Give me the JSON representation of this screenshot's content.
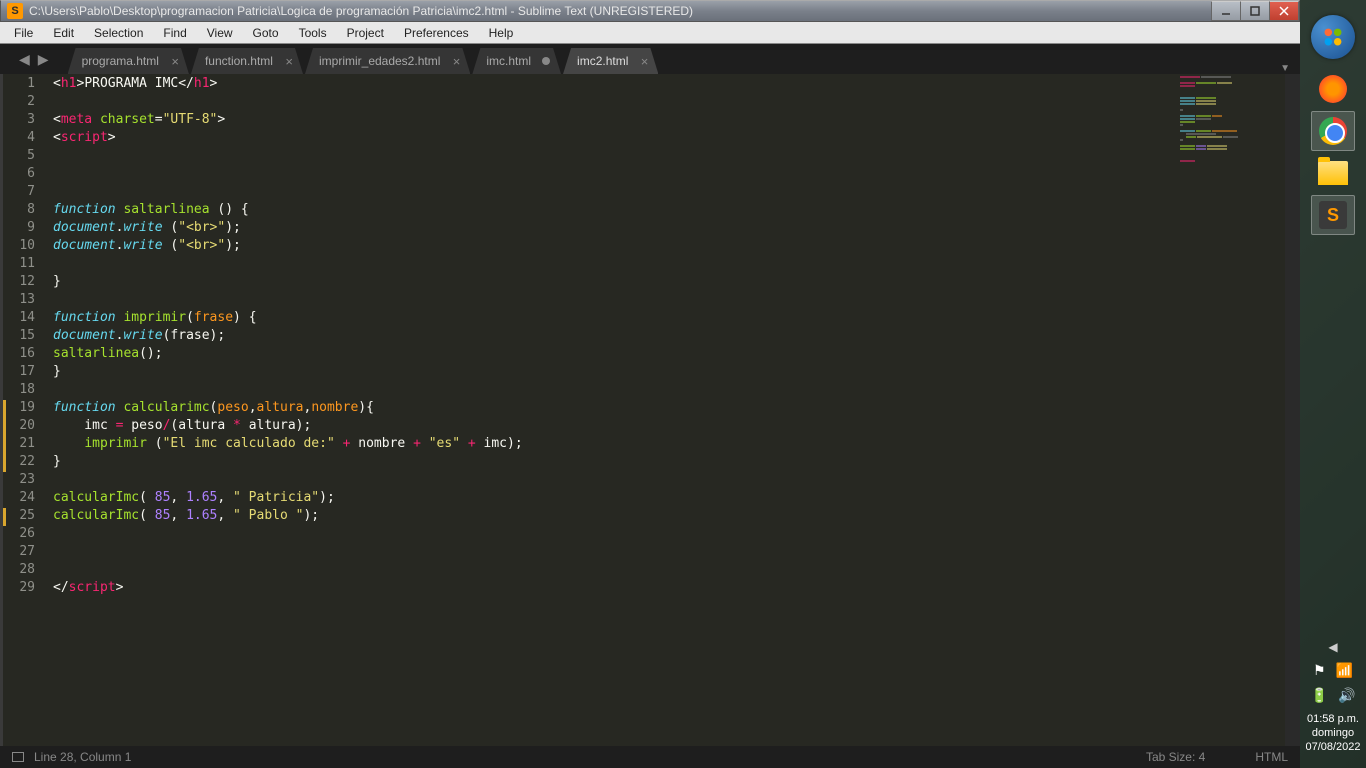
{
  "titlebar": {
    "icon_letter": "S",
    "text": "C:\\Users\\Pablo\\Desktop\\programacion Patricia\\Logica de programación Patricia\\imc2.html - Sublime Text (UNREGISTERED)"
  },
  "menu": [
    "File",
    "Edit",
    "Selection",
    "Find",
    "View",
    "Goto",
    "Tools",
    "Project",
    "Preferences",
    "Help"
  ],
  "tabs": [
    {
      "label": "programa.html",
      "modified": false,
      "active": false
    },
    {
      "label": "function.html",
      "modified": false,
      "active": false
    },
    {
      "label": "imprimir_edades2.html",
      "modified": false,
      "active": false
    },
    {
      "label": "imc.html",
      "modified": true,
      "active": false
    },
    {
      "label": "imc2.html",
      "modified": false,
      "active": true
    }
  ],
  "line_count": 29,
  "accent_lines": [
    19,
    20,
    21,
    22,
    25
  ],
  "code": {
    "l1": {
      "a": "<",
      "b": "h1",
      "c": ">",
      "d": "PROGRAMA IMC",
      "e": "</",
      "f": "h1",
      "g": ">"
    },
    "l3": {
      "a": "<",
      "b": "meta ",
      "c": "charset",
      "d": "=",
      "e": "\"UTF-8\"",
      "f": ">"
    },
    "l4": {
      "a": "<",
      "b": "script",
      "c": ">"
    },
    "l8": {
      "a": "function",
      "b": " saltarlinea",
      "c": " () {"
    },
    "l9": {
      "a": "document",
      "b": ".",
      "c": "write",
      "d": " (",
      "e": "\"<br>\"",
      "f": ");"
    },
    "l10": {
      "a": "document",
      "b": ".",
      "c": "write",
      "d": " (",
      "e": "\"<br>\"",
      "f": ");"
    },
    "l12": {
      "a": "}"
    },
    "l14": {
      "a": "function",
      "b": " imprimir",
      "c": "(",
      "d": "frase",
      "e": ") {"
    },
    "l15": {
      "a": "document",
      "b": ".",
      "c": "write",
      "d": "(frase);"
    },
    "l16": {
      "a": "saltarlinea",
      "b": "();"
    },
    "l17": {
      "a": "}"
    },
    "l19": {
      "a": "function",
      "b": " calcularimc",
      "c": "(",
      "d": "peso",
      "e": ",",
      "f": "altura",
      "g": ",",
      "h": "nombre",
      "i": "){"
    },
    "l20": {
      "a": "    imc ",
      "b": "=",
      "c": " peso",
      "d": "/",
      "e": "(altura ",
      "f": "*",
      "g": " altura);"
    },
    "l21": {
      "a": "    ",
      "b": "imprimir",
      "c": " (",
      "d": "\"El imc calculado de:\"",
      "e": " + ",
      "f": "nombre ",
      "g": "+ ",
      "h": "\"es\"",
      "i": " + ",
      "j": "imc);"
    },
    "l22": {
      "a": "}"
    },
    "l24": {
      "a": "calcularImc",
      "b": "( ",
      "c": "85",
      "d": ", ",
      "e": "1.65",
      "f": ", ",
      "g": "\" Patricia\"",
      "h": ");"
    },
    "l25": {
      "a": "calcularImc",
      "b": "( ",
      "c": "85",
      "d": ", ",
      "e": "1.65",
      "f": ", ",
      "g": "\" Pablo \"",
      "h": ");"
    },
    "l29": {
      "a": "</",
      "b": "script",
      "c": ">"
    }
  },
  "status": {
    "left": "Line 28, Column 1",
    "tab_size": "Tab Size: 4",
    "syntax": "HTML"
  },
  "clock": {
    "time": "01:58 p.m.",
    "day": "domingo",
    "date": "07/08/2022"
  }
}
